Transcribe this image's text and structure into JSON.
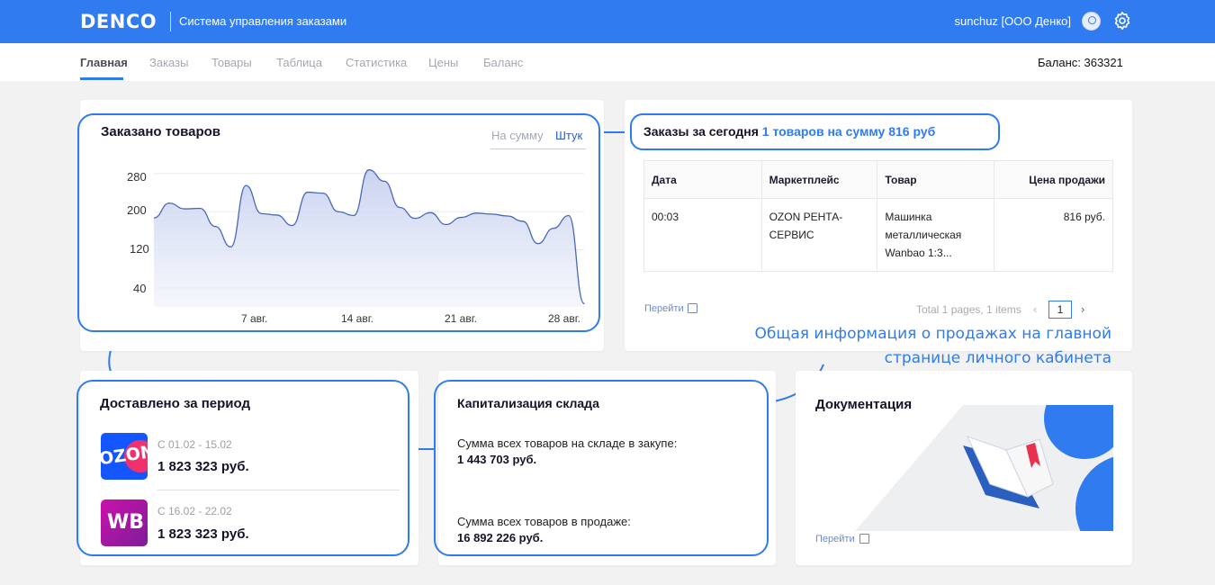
{
  "header": {
    "logo": "DENCO",
    "app_name": "Система управления заказами",
    "user": "sunchuz [ООО Денко]",
    "brand_color": "#2f7bef"
  },
  "nav": {
    "items": [
      {
        "label": "Главная",
        "active": true
      },
      {
        "label": "Заказы"
      },
      {
        "label": "Товары"
      },
      {
        "label": "Таблица"
      },
      {
        "label": "Статистика"
      },
      {
        "label": "Цены"
      },
      {
        "label": "Баланс"
      }
    ],
    "balance": "Баланс: 363321"
  },
  "ordered": {
    "title": "Заказано товаров",
    "toggle_sum": "На сумму",
    "toggle_pcs": "Штук",
    "chart_data": {
      "type": "area",
      "x_labels": [
        "7 авг.",
        "14 авг.",
        "21 авг.",
        "28 авг."
      ],
      "x": [
        "1 авг.",
        "2 авг.",
        "3 авг.",
        "4 авг.",
        "5 авг.",
        "6 авг.",
        "7 авг.",
        "8 авг.",
        "9 авг.",
        "10 авг.",
        "11 авг.",
        "12 авг.",
        "13 авг.",
        "14 авг.",
        "15 авг.",
        "16 авг.",
        "17 авг.",
        "18 авг.",
        "19 авг.",
        "20 авг.",
        "21 авг.",
        "22 авг.",
        "23 авг.",
        "24 авг.",
        "25 авг.",
        "26 авг.",
        "27 авг.",
        "28 авг.",
        "29 авг."
      ],
      "values": [
        187,
        218,
        206,
        207,
        169,
        126,
        255,
        196,
        193,
        171,
        241,
        239,
        200,
        192,
        288,
        264,
        209,
        186,
        198,
        173,
        188,
        197,
        195,
        191,
        180,
        133,
        165,
        192,
        7
      ],
      "yticks": [
        40,
        120,
        200,
        280
      ],
      "ylim": [
        0,
        295
      ]
    }
  },
  "today": {
    "title_prefix": "Заказы за сегодня",
    "title_highlight": "1 товаров на сумму 816 руб",
    "columns": [
      "Дата",
      "Маркетплейс",
      "Товар",
      "Цена продажи"
    ],
    "rows": [
      [
        "00:03",
        "OZON РЕНТА-СЕРВИС",
        "Машинка металлическая Wanbao 1:3...",
        "816 руб."
      ]
    ],
    "link": "Перейти",
    "pagination_text": "Total 1 pages, 1 items",
    "page": "1"
  },
  "annotation": {
    "line1": "Общая информация о продажах на главной",
    "line2": "странице личного кабинета"
  },
  "delivered": {
    "title": "Доставлено за период",
    "items": [
      {
        "brand": "OZON",
        "period": "С 01.02 - 15.02",
        "amount": "1 823 323 руб.",
        "color": "#1355ff"
      },
      {
        "brand": "WB",
        "period": "С 16.02 - 22.02",
        "amount": "1 823 323 руб.",
        "color": "#cb11ab"
      }
    ]
  },
  "warehouse": {
    "title": "Капитализация склада",
    "purchase_label": "Сумма всех товаров на складе в закупе:",
    "purchase_value": "1 443 703 руб.",
    "sale_label": "Сумма всех товаров в продаже:",
    "sale_value": "16 892 226 руб."
  },
  "docs": {
    "title": "Документация",
    "link": "Перейти"
  }
}
